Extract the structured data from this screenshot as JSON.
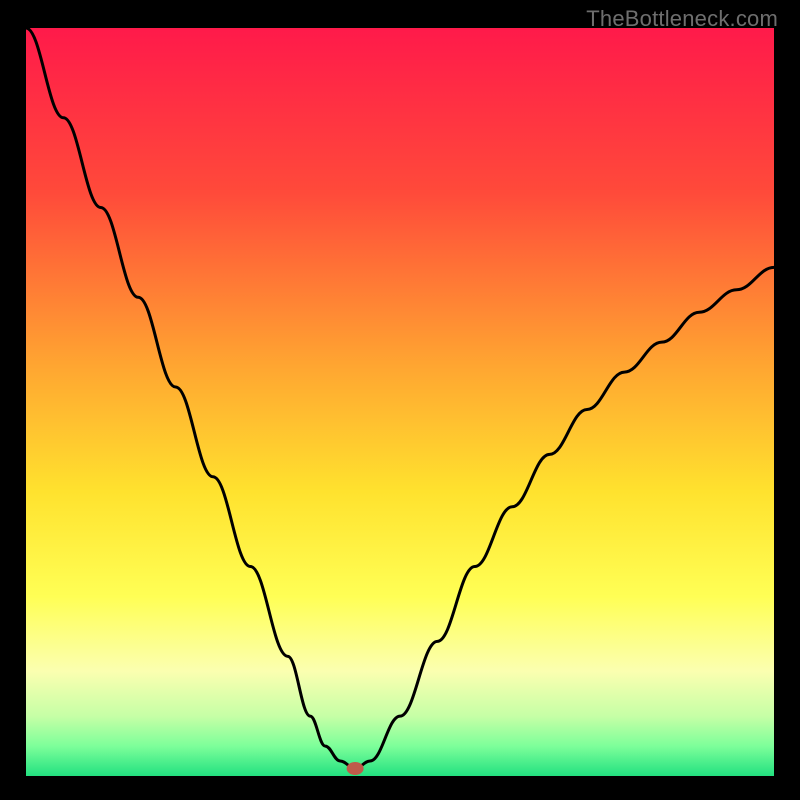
{
  "watermark": "TheBottleneck.com",
  "chart_data": {
    "type": "line",
    "title": "",
    "xlabel": "",
    "ylabel": "",
    "xlim": [
      0,
      100
    ],
    "ylim": [
      0,
      100
    ],
    "gradient_stops": [
      {
        "offset": 0,
        "color": "#ff1a4a"
      },
      {
        "offset": 22,
        "color": "#ff4a3a"
      },
      {
        "offset": 45,
        "color": "#ffa531"
      },
      {
        "offset": 62,
        "color": "#ffe22e"
      },
      {
        "offset": 76,
        "color": "#ffff55"
      },
      {
        "offset": 86,
        "color": "#fbffb0"
      },
      {
        "offset": 92,
        "color": "#c6ffa6"
      },
      {
        "offset": 96,
        "color": "#7dff9a"
      },
      {
        "offset": 100,
        "color": "#22e180"
      }
    ],
    "series": [
      {
        "name": "bottleneck-curve",
        "x": [
          0,
          5,
          10,
          15,
          20,
          25,
          30,
          35,
          38,
          40,
          42,
          44,
          46,
          50,
          55,
          60,
          65,
          70,
          75,
          80,
          85,
          90,
          95,
          100
        ],
        "y": [
          100,
          88,
          76,
          64,
          52,
          40,
          28,
          16,
          8,
          4,
          2,
          1,
          2,
          8,
          18,
          28,
          36,
          43,
          49,
          54,
          58,
          62,
          65,
          68
        ]
      }
    ],
    "marker": {
      "x": 44,
      "y": 1,
      "name": "optimal-point"
    }
  }
}
